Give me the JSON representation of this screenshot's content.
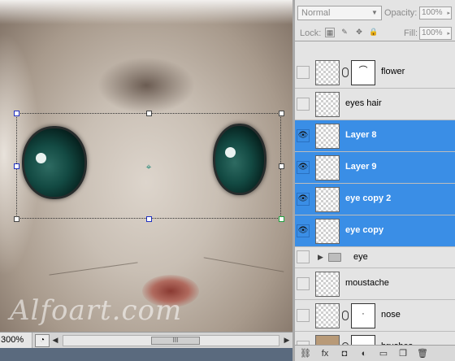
{
  "canvas": {
    "watermark": "Alfoart.com"
  },
  "status_bar": {
    "zoom": "300%",
    "left_arrow": "◀",
    "right_arrow": "▶",
    "thumb_grip": "III"
  },
  "layers_panel": {
    "blend_mode": "Normal",
    "opacity_label": "Opacity:",
    "opacity_value": "100%",
    "lock_label": "Lock:",
    "fill_label": "Fill:",
    "fill_value": "100%",
    "layers": [
      {
        "name": "flower",
        "visible": false,
        "selected": false,
        "has_mask": true,
        "mask_glyph": "⌒"
      },
      {
        "name": "eyes hair",
        "visible": false,
        "selected": false,
        "has_mask": false
      },
      {
        "name": "Layer 8",
        "visible": true,
        "selected": true,
        "has_mask": false
      },
      {
        "name": "Layer 9",
        "visible": true,
        "selected": true,
        "has_mask": false
      },
      {
        "name": "eye copy 2",
        "visible": true,
        "selected": true,
        "has_mask": false
      },
      {
        "name": "eye copy",
        "visible": true,
        "selected": true,
        "has_mask": false
      },
      {
        "name": "eye",
        "visible": false,
        "selected": false,
        "group": true
      },
      {
        "name": "moustache",
        "visible": false,
        "selected": false,
        "has_mask": false
      },
      {
        "name": "nose",
        "visible": false,
        "selected": false,
        "has_mask": true,
        "mask_glyph": "·"
      },
      {
        "name": "brushes",
        "visible": false,
        "selected": false,
        "has_mask": true,
        "mask_glyph": ""
      }
    ],
    "eye_glyph": "👁",
    "footer_icons": [
      "link-icon",
      "fx-icon",
      "mask-icon",
      "adjustment-icon",
      "group-icon",
      "new-layer-icon",
      "trash-icon"
    ],
    "footer_glyphs": [
      "⛓",
      "fx",
      "◘",
      "◐",
      "▭",
      "❐",
      "🗑"
    ]
  },
  "colors": {
    "selection": "#3a8ee6",
    "panel_bg": "#e4e4e4"
  }
}
